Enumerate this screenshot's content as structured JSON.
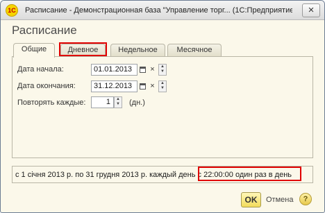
{
  "window": {
    "title": "Расписание - Демонстрационная база \"Управление торг... (1С:Предприятие)",
    "icon_text": "1С",
    "close_glyph": "×"
  },
  "page_title": "Расписание",
  "tabs": [
    {
      "label": "Общие",
      "active": true
    },
    {
      "label": "Дневное",
      "active": false,
      "highlighted": true
    },
    {
      "label": "Недельное",
      "active": false
    },
    {
      "label": "Месячное",
      "active": false
    }
  ],
  "form": {
    "start_label": "Дата начала:",
    "start_value": "01.01.2013",
    "end_label": "Дата окончания:",
    "end_value": "31.12.2013",
    "repeat_label": "Повторять каждые:",
    "repeat_value": "1",
    "repeat_unit": "(дн.)",
    "clear_glyph": "×",
    "spin_up": "▲",
    "spin_down": "▼"
  },
  "summary": {
    "text_main": "с 1 січня 2013 р. по 31 грудня 2013 р. каждый  день",
    "text_highlighted": "с 22:00:00 один раз в день"
  },
  "footer": {
    "ok_label": "OK",
    "cancel_label": "Отмена",
    "help_label": "?"
  },
  "colors": {
    "highlight": "#e00000",
    "background": "#fbf8ea",
    "ok_button": "#f2dc5b"
  }
}
